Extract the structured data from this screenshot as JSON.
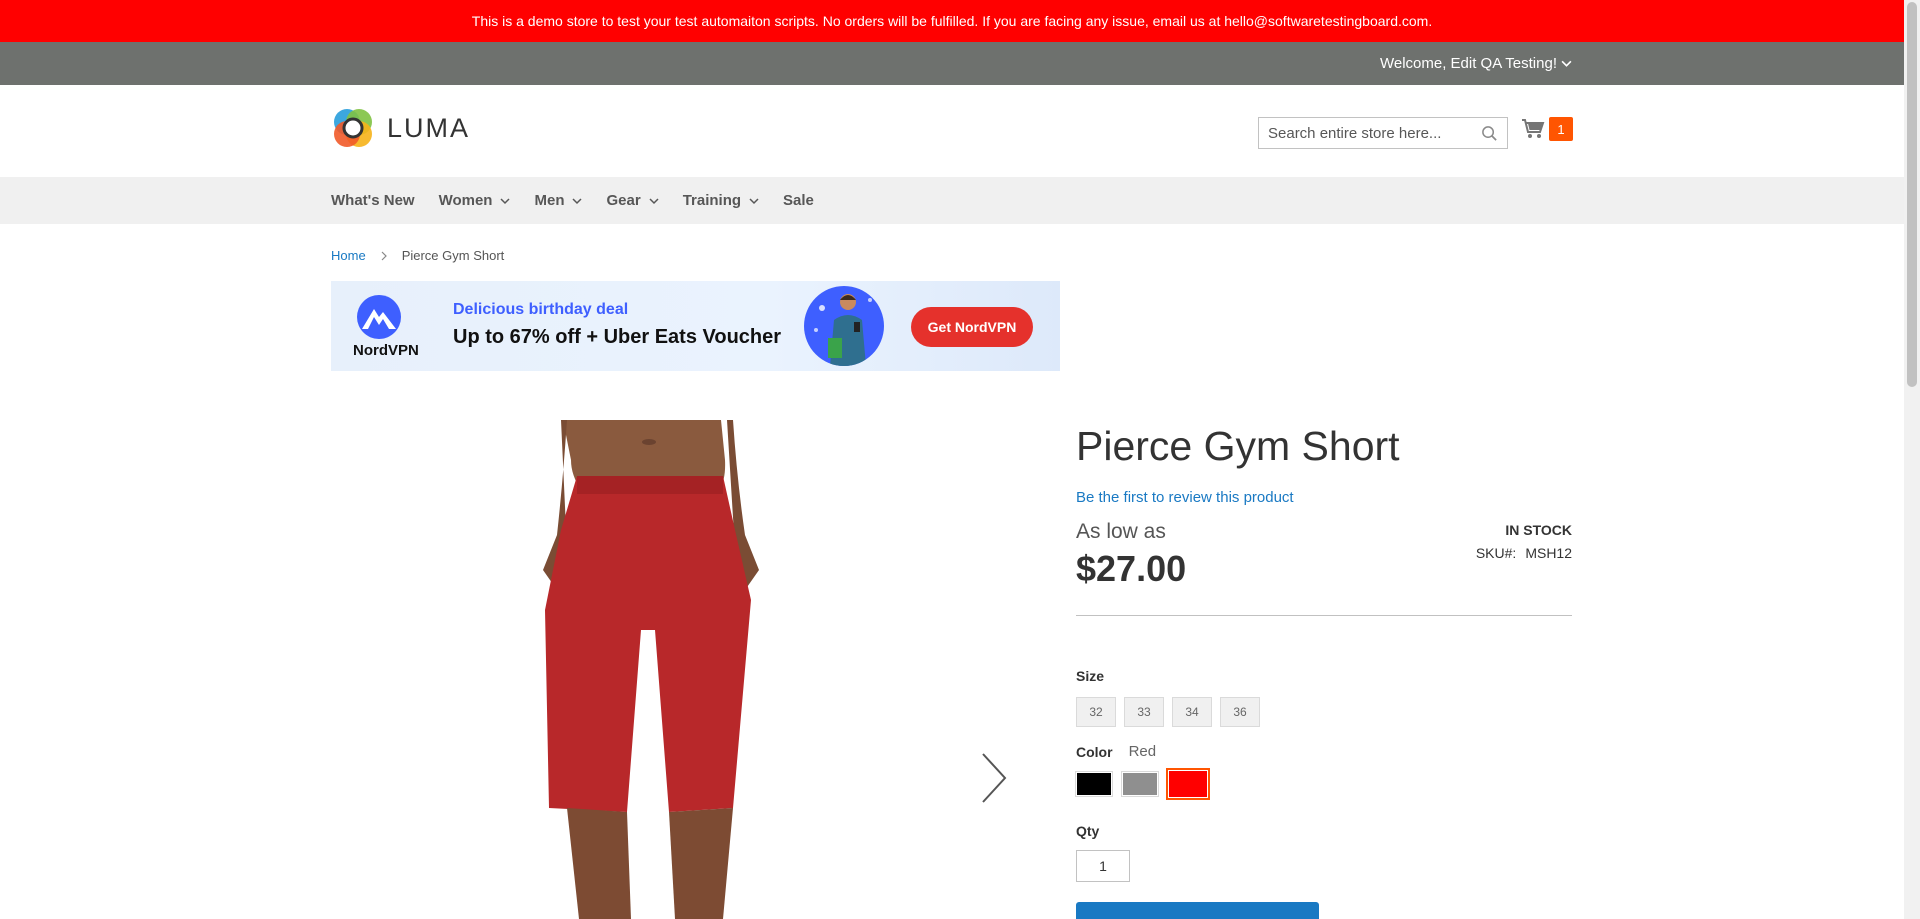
{
  "demo_notice": "This is a demo store to test your test automaiton scripts. No orders will be fulfilled. If you are facing any issue, email us at hello@softwaretestingboard.com.",
  "welcome": "Welcome, Edit QA Testing!",
  "logo_text": "LUMA",
  "search": {
    "placeholder": "Search entire store here..."
  },
  "cart": {
    "count": "1"
  },
  "nav": {
    "items": [
      {
        "label": "What's New"
      },
      {
        "label": "Women"
      },
      {
        "label": "Men"
      },
      {
        "label": "Gear"
      },
      {
        "label": "Training"
      },
      {
        "label": "Sale"
      }
    ]
  },
  "breadcrumb": {
    "home": "Home",
    "current": "Pierce Gym Short"
  },
  "ad": {
    "brand": "NordVPN",
    "headline": "Delicious birthday deal",
    "subline": "Up to 67% off + Uber Eats Voucher",
    "cta": "Get NordVPN"
  },
  "product": {
    "title": "Pierce Gym Short",
    "review_link": "Be the first to review this product",
    "as_low_as": "As low as",
    "price": "$27.00",
    "stock": "IN STOCK",
    "sku_label": "SKU#:",
    "sku": "MSH12",
    "size_label": "Size",
    "sizes": [
      "32",
      "33",
      "34",
      "36"
    ],
    "color_label": "Color",
    "color_selected": "Red",
    "colors": [
      "#000000",
      "#8f8f8f",
      "#ff0000"
    ],
    "qty_label": "Qty",
    "qty": "1"
  }
}
